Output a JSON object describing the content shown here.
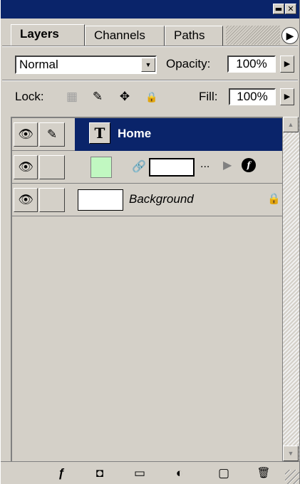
{
  "window": {
    "minimize_glyph": "▬",
    "close_glyph": "✕"
  },
  "tabs": [
    {
      "label": "Layers",
      "active": true
    },
    {
      "label": "Channels",
      "active": false
    },
    {
      "label": "Paths",
      "active": false
    }
  ],
  "tab_menu_glyph": "▶",
  "blend": {
    "value": "Normal",
    "arrow": "▼"
  },
  "opacity": {
    "label": "Opacity:",
    "value": "100%",
    "arrow": "▶"
  },
  "lock": {
    "label": "Lock:",
    "icons": [
      "transparent-pixels-lock-icon",
      "brush-lock-icon",
      "move-lock-icon",
      "padlock-icon"
    ],
    "glyphs": [
      "▦",
      "✎",
      "✥",
      "🔒"
    ]
  },
  "fill": {
    "label": "Fill:",
    "value": "100%",
    "arrow": "▶"
  },
  "layers": [
    {
      "name": "Home",
      "type": "text",
      "selected": true,
      "visible": true,
      "thumb_glyph": "T"
    },
    {
      "name": "",
      "type": "fill",
      "selected": false,
      "visible": true,
      "thumb_color": "#c1f8c1",
      "dots": "...",
      "fx_arrow": "▶",
      "fx_label": "f"
    },
    {
      "name": "Background",
      "type": "background",
      "selected": false,
      "visible": true,
      "locked": true
    }
  ],
  "colors": {
    "selection": "#0a246a",
    "panel": "#d4d0c8",
    "fill_thumb": "#c1f8c1"
  },
  "bottom_toolbar": {
    "icons": [
      "layer-style-icon",
      "layer-mask-icon",
      "new-group-icon",
      "adjustment-layer-icon",
      "new-layer-icon",
      "trash-icon"
    ],
    "glyphs": [
      "ƒ",
      "◘",
      "▭",
      "◐",
      "▢",
      "🗑"
    ]
  },
  "eye_glyph": "👁",
  "brush_glyph": "✎",
  "chain_glyph": "🔗",
  "scroll_up": "▲",
  "scroll_down": "▼",
  "lock_glyph": "🔒"
}
